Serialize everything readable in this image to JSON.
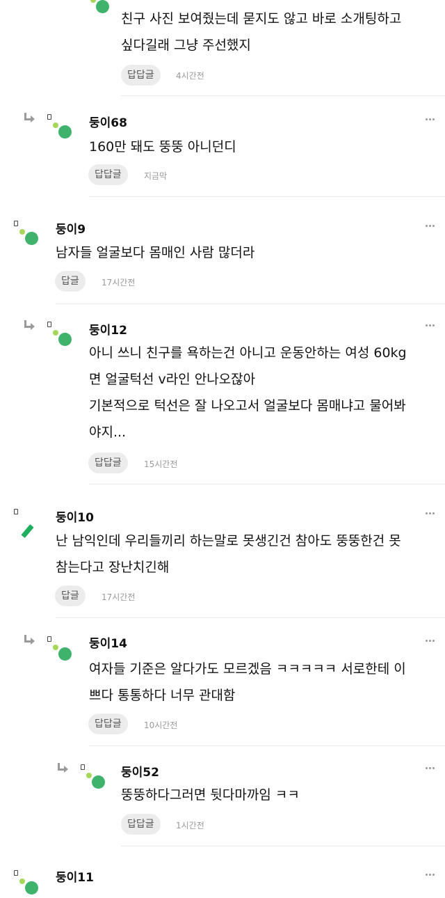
{
  "comments": [
    {
      "username": "",
      "text": "친구 사진 보여줬는데 묻지도 않고 바로 소개팅하고\n싶다길래 그냥 주선했지",
      "reply_label": "답답글",
      "time": "4시간전"
    },
    {
      "username": "둥이68",
      "text": "160만 돼도 뚱뚱 아니던디",
      "reply_label": "답답글",
      "time": "지금막"
    },
    {
      "username": "둥이9",
      "text": "남자들 얼굴보다 몸매인 사람 많더라",
      "reply_label": "답글",
      "time": "17시간전"
    },
    {
      "username": "둥이12",
      "text": "아니 쓰니 친구를 욕하는건 아니고 운동안하는 여성 60kg\n면 얼굴턱선 v라인 안나오잖아\n기본적으로 턱선은 잘 나오고서 얼굴보다 몸매냐고 물어봐\n야지...",
      "reply_label": "답답글",
      "time": "15시간전"
    },
    {
      "username": "둥이10",
      "text": "난 남익인데 우리들끼리 하는말로 못생긴건 참아도 뚱뚱한건 못\n참는다고 장난치긴해",
      "reply_label": "답글",
      "time": "17시간전"
    },
    {
      "username": "둥이14",
      "text": "여자들 기준은 알다가도 모르겠음 ㅋㅋㅋㅋㅋ 서로한테 이\n쁘다 통통하다 너무 관대함",
      "reply_label": "답답글",
      "time": "10시간전"
    },
    {
      "username": "둥이52",
      "text": "뚱뚱하다그러면 뒷다마까임 ㅋㅋ",
      "reply_label": "답답글",
      "time": "1시간전"
    },
    {
      "username": "둥이11",
      "text": "",
      "reply_label": "",
      "time": ""
    }
  ]
}
